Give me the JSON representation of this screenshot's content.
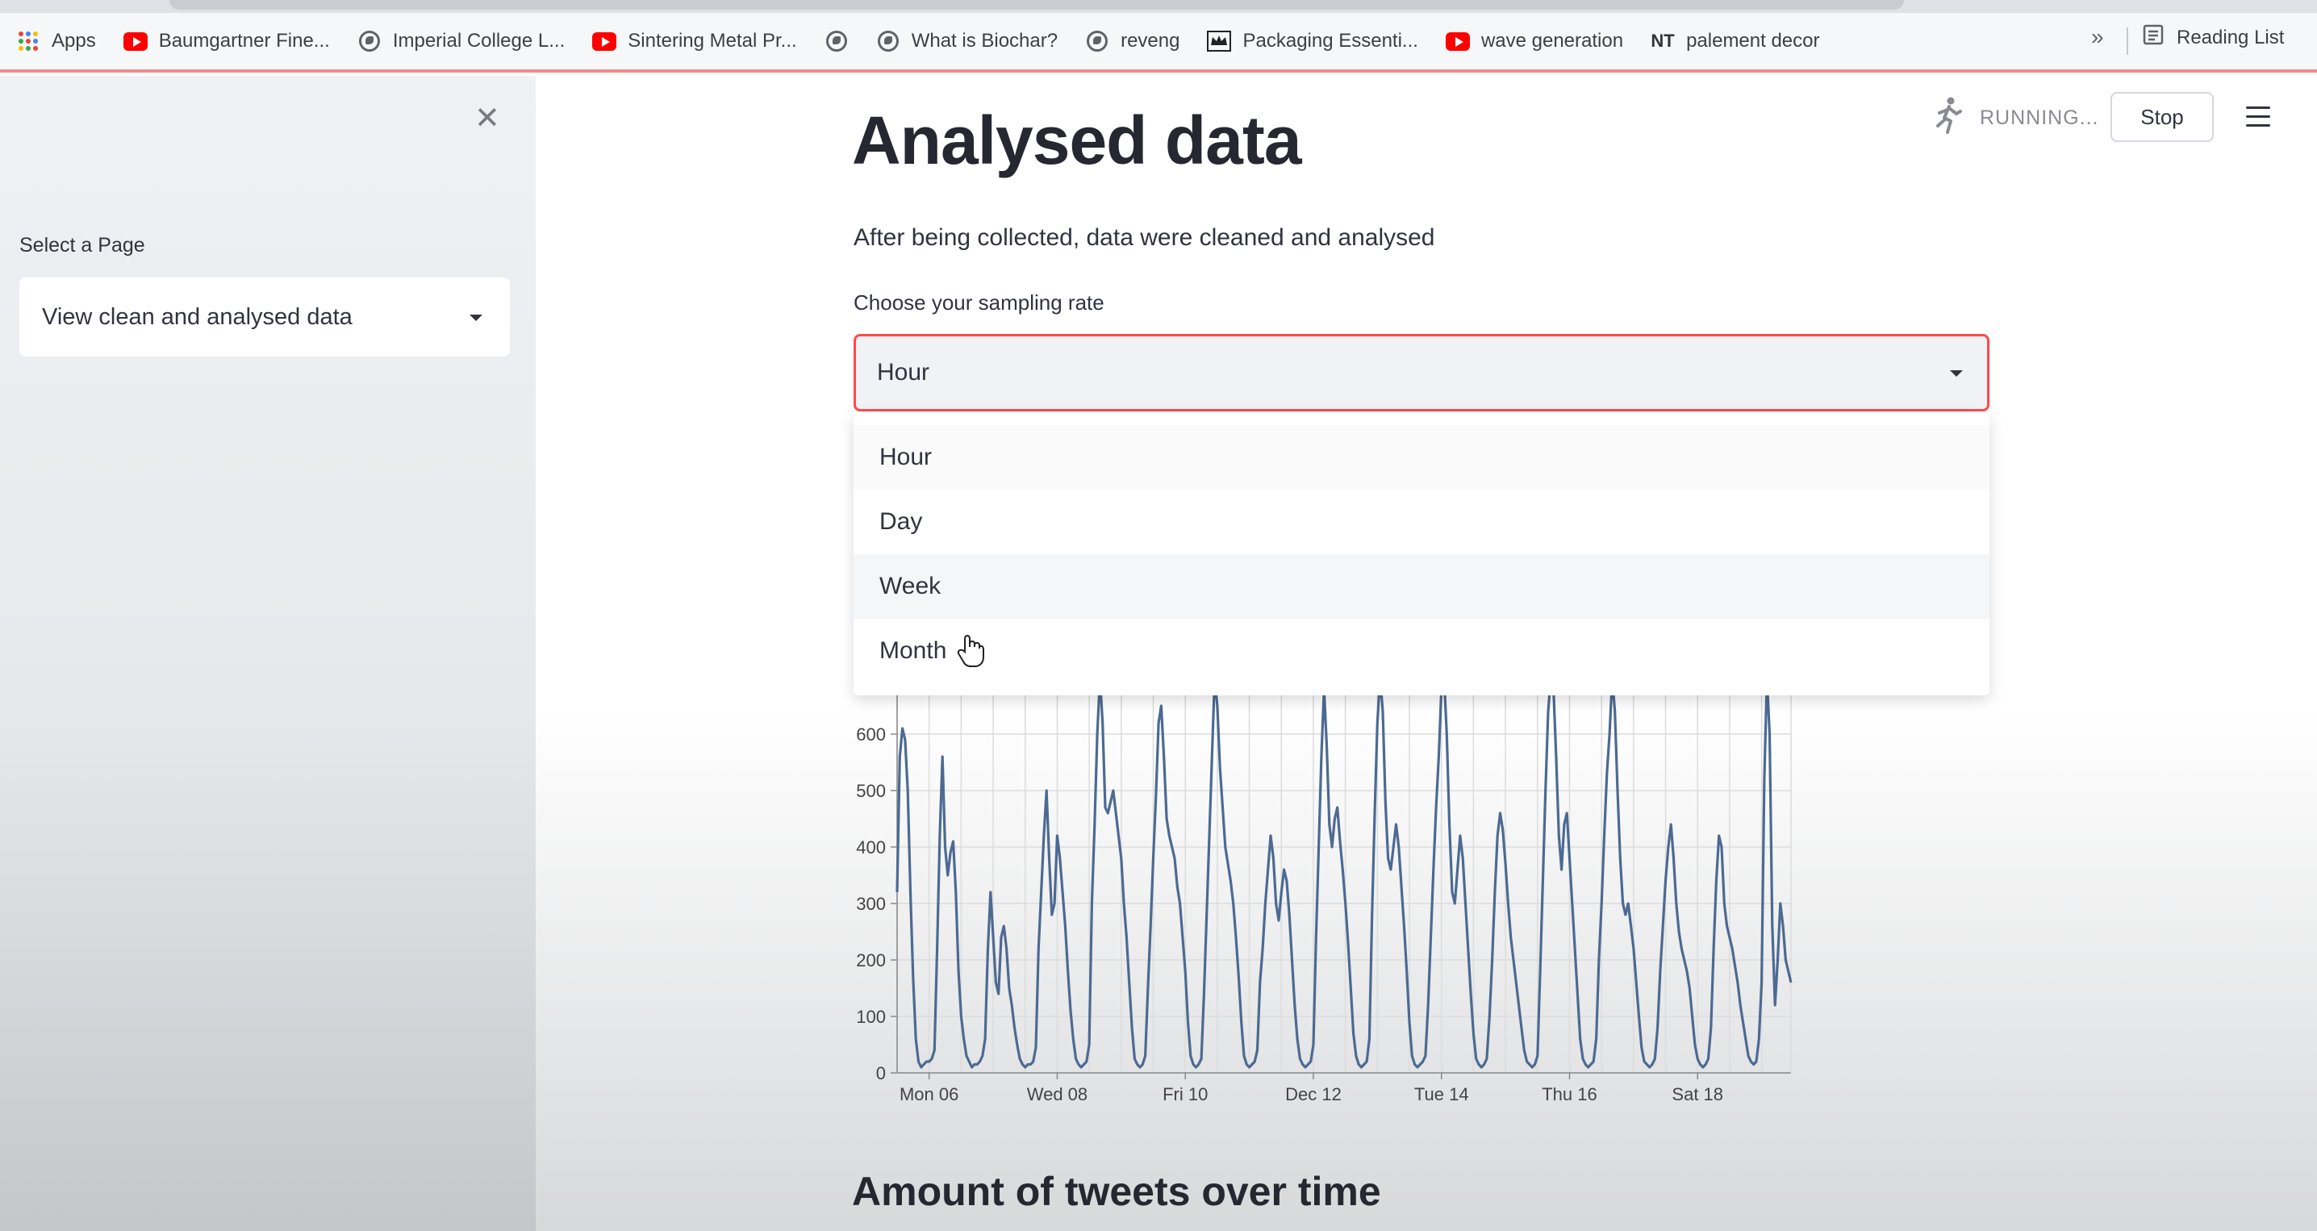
{
  "browser": {
    "bookmarks": [
      {
        "label": "Apps",
        "icon": "apps-grid-icon"
      },
      {
        "label": "Baumgartner Fine...",
        "icon": "youtube-icon"
      },
      {
        "label": "Imperial College L...",
        "icon": "globe-icon"
      },
      {
        "label": "Sintering Metal Pr...",
        "icon": "youtube-icon"
      },
      {
        "label": "",
        "icon": "globe-icon"
      },
      {
        "label": "What is Biochar?",
        "icon": "globe-icon"
      },
      {
        "label": "reveng",
        "icon": "globe-icon"
      },
      {
        "label": "Packaging Essenti...",
        "icon": "crown-logo-icon"
      },
      {
        "label": "wave generation",
        "icon": "youtube-icon"
      },
      {
        "label": "palement decor",
        "icon": "nt-logo-icon",
        "icon_text": "NT"
      }
    ],
    "more": "»",
    "reading_list": "Reading List"
  },
  "sidebar": {
    "close": "✕",
    "select_label": "Select a Page",
    "selected_page": "View clean and analysed data"
  },
  "header": {
    "status": "RUNNING...",
    "stop_label": "Stop"
  },
  "main": {
    "title": "Analysed data",
    "intro": "After being collected, data were cleaned and analysed",
    "rate_label": "Choose your sampling rate",
    "rate_selected": "Hour",
    "rate_options": [
      "Hour",
      "Day",
      "Week",
      "Month"
    ],
    "section_title": "Amount of tweets over time"
  },
  "colors": {
    "accent": "#ff4b4b",
    "line": "#4c6a92",
    "sidebar_bg": "#f0f2f6"
  },
  "chart_data": {
    "type": "line",
    "ylim": [
      0,
      700
    ],
    "yticks": [
      0,
      100,
      200,
      300,
      400,
      500,
      600
    ],
    "xticks": [
      {
        "label": "Mon 06",
        "hour": 12
      },
      {
        "label": "Wed 08",
        "hour": 60
      },
      {
        "label": "Fri 10",
        "hour": 108
      },
      {
        "label": "Dec 12",
        "hour": 156
      },
      {
        "label": "Tue 14",
        "hour": 204
      },
      {
        "label": "Thu 16",
        "hour": 252
      },
      {
        "label": "Sat 18",
        "hour": 300
      }
    ],
    "series": [
      {
        "values": [
          320,
          560,
          610,
          590,
          500,
          320,
          170,
          60,
          20,
          10,
          15,
          20,
          20,
          25,
          40,
          220,
          420,
          560,
          400,
          350,
          390,
          410,
          320,
          180,
          100,
          60,
          30,
          20,
          10,
          15,
          15,
          20,
          30,
          60,
          220,
          320,
          240,
          160,
          140,
          240,
          260,
          220,
          150,
          120,
          80,
          50,
          25,
          15,
          10,
          15,
          15,
          20,
          45,
          220,
          320,
          420,
          500,
          380,
          280,
          300,
          420,
          380,
          320,
          260,
          180,
          110,
          60,
          25,
          15,
          10,
          15,
          20,
          50,
          300,
          440,
          600,
          720,
          620,
          470,
          460,
          480,
          500,
          460,
          420,
          380,
          300,
          240,
          160,
          80,
          25,
          15,
          10,
          15,
          30,
          150,
          260,
          380,
          490,
          620,
          650,
          560,
          450,
          420,
          400,
          380,
          330,
          300,
          240,
          180,
          90,
          30,
          15,
          10,
          15,
          25,
          140,
          280,
          420,
          560,
          700,
          650,
          540,
          470,
          400,
          370,
          340,
          300,
          240,
          170,
          90,
          30,
          15,
          10,
          15,
          20,
          40,
          160,
          220,
          300,
          360,
          420,
          380,
          300,
          270,
          320,
          360,
          340,
          280,
          200,
          120,
          60,
          25,
          15,
          10,
          15,
          20,
          50,
          240,
          400,
          560,
          680,
          580,
          440,
          400,
          450,
          470,
          410,
          360,
          300,
          230,
          150,
          70,
          30,
          15,
          10,
          15,
          20,
          60,
          280,
          460,
          620,
          720,
          640,
          480,
          380,
          360,
          400,
          440,
          400,
          330,
          260,
          180,
          90,
          30,
          15,
          10,
          15,
          20,
          30,
          120,
          240,
          360,
          470,
          560,
          680,
          720,
          600,
          440,
          320,
          300,
          360,
          420,
          380,
          300,
          220,
          140,
          70,
          25,
          15,
          10,
          15,
          25,
          100,
          200,
          320,
          420,
          460,
          430,
          370,
          300,
          240,
          200,
          160,
          120,
          80,
          40,
          20,
          15,
          10,
          15,
          30,
          180,
          340,
          500,
          640,
          700,
          680,
          560,
          420,
          360,
          440,
          460,
          380,
          300,
          220,
          140,
          60,
          25,
          15,
          10,
          15,
          20,
          60,
          200,
          300,
          420,
          530,
          600,
          720,
          640,
          500,
          380,
          300,
          280,
          300,
          260,
          220,
          160,
          100,
          45,
          20,
          15,
          10,
          15,
          25,
          80,
          180,
          260,
          340,
          400,
          440,
          380,
          300,
          250,
          220,
          200,
          180,
          150,
          100,
          50,
          25,
          15,
          10,
          15,
          25,
          80,
          220,
          340,
          420,
          400,
          300,
          260,
          240,
          220,
          190,
          160,
          120,
          90,
          60,
          30,
          20,
          15,
          20,
          60,
          160,
          520,
          700,
          600,
          260,
          120,
          200,
          300,
          260,
          200,
          180,
          160
        ]
      }
    ]
  }
}
